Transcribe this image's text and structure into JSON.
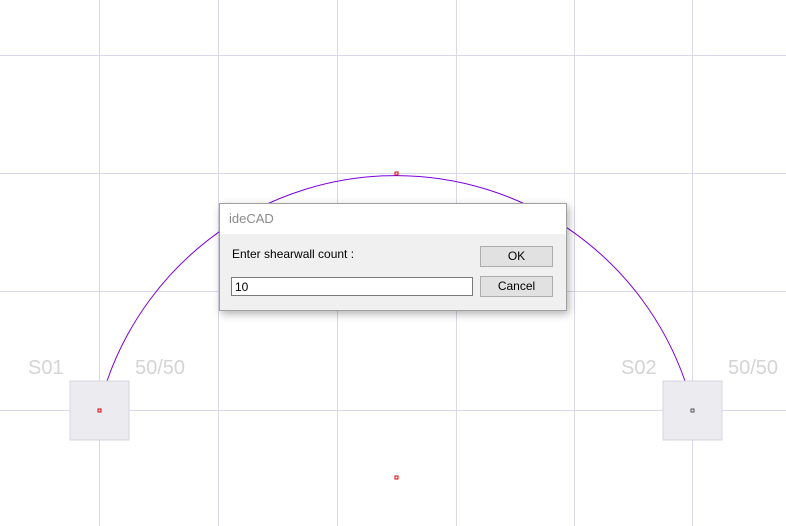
{
  "canvas": {
    "arc_color": "#7b00e0",
    "grid_color": "#d8d8e8",
    "columns": [
      {
        "name": "S01",
        "size": "50/50"
      },
      {
        "name": "S02",
        "size": "50/50"
      }
    ]
  },
  "dialog": {
    "title": "ideCAD",
    "prompt": "Enter shearwall count :",
    "value": "10",
    "ok_label": "OK",
    "cancel_label": "Cancel"
  }
}
